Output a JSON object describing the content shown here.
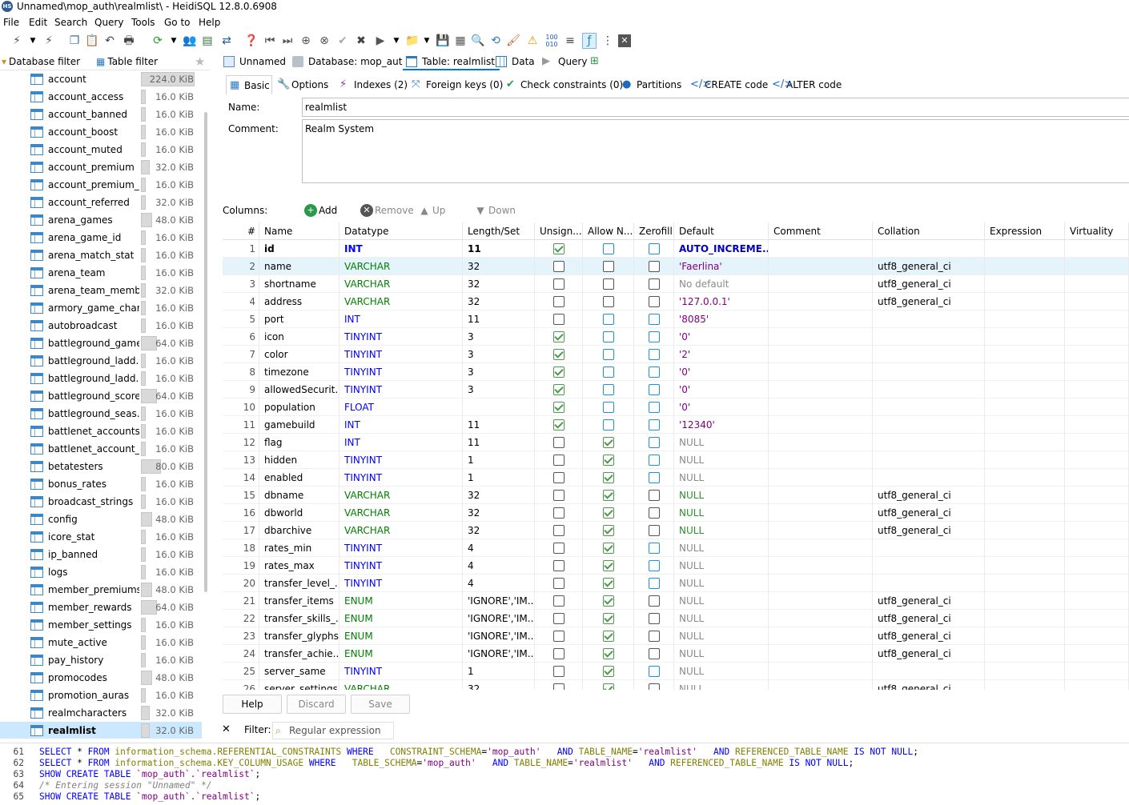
{
  "window": {
    "title": "Unnamed\\mop_auth\\realmlist\\ - HeidiSQL 12.8.0.6908",
    "app_icon": "HS"
  },
  "menu": [
    "File",
    "Edit",
    "Search",
    "Query",
    "Tools",
    "Go to",
    "Help"
  ],
  "left_tabs": {
    "database_filter": "Database filter",
    "table_filter": "Table filter"
  },
  "tree": [
    {
      "name": "account",
      "size": "224.0 KiB",
      "bar": 0.95
    },
    {
      "name": "account_access",
      "size": "16.0 KiB",
      "bar": 0.05
    },
    {
      "name": "account_banned",
      "size": "16.0 KiB",
      "bar": 0.05
    },
    {
      "name": "account_boost",
      "size": "16.0 KiB",
      "bar": 0.05
    },
    {
      "name": "account_muted",
      "size": "16.0 KiB",
      "bar": 0.05
    },
    {
      "name": "account_premium",
      "size": "32.0 KiB",
      "bar": 0.15
    },
    {
      "name": "account_premium_...",
      "size": "16.0 KiB",
      "bar": 0.05
    },
    {
      "name": "account_referred",
      "size": "32.0 KiB",
      "bar": 0.05
    },
    {
      "name": "arena_games",
      "size": "48.0 KiB",
      "bar": 0.2
    },
    {
      "name": "arena_game_id",
      "size": "16.0 KiB",
      "bar": 0.05
    },
    {
      "name": "arena_match_stat",
      "size": "16.0 KiB",
      "bar": 0.05
    },
    {
      "name": "arena_team",
      "size": "16.0 KiB",
      "bar": 0.05
    },
    {
      "name": "arena_team_member",
      "size": "32.0 KiB",
      "bar": 0.05
    },
    {
      "name": "armory_game_chart",
      "size": "16.0 KiB",
      "bar": 0.05
    },
    {
      "name": "autobroadcast",
      "size": "16.0 KiB",
      "bar": 0.05
    },
    {
      "name": "battleground_games",
      "size": "64.0 KiB",
      "bar": 0.28
    },
    {
      "name": "battleground_ladd...",
      "size": "16.0 KiB",
      "bar": 0.05
    },
    {
      "name": "battleground_ladd...",
      "size": "16.0 KiB",
      "bar": 0.05
    },
    {
      "name": "battleground_scores",
      "size": "64.0 KiB",
      "bar": 0.28
    },
    {
      "name": "battleground_seas...",
      "size": "16.0 KiB",
      "bar": 0.05
    },
    {
      "name": "battlenet_accounts",
      "size": "16.0 KiB",
      "bar": 0.05
    },
    {
      "name": "battlenet_account_...",
      "size": "16.0 KiB",
      "bar": 0.05
    },
    {
      "name": "betatesters",
      "size": "80.0 KiB",
      "bar": 0.36
    },
    {
      "name": "bonus_rates",
      "size": "16.0 KiB",
      "bar": 0.05
    },
    {
      "name": "broadcast_strings",
      "size": "16.0 KiB",
      "bar": 0.05
    },
    {
      "name": "config",
      "size": "48.0 KiB",
      "bar": 0.2
    },
    {
      "name": "icore_stat",
      "size": "16.0 KiB",
      "bar": 0.05
    },
    {
      "name": "ip_banned",
      "size": "16.0 KiB",
      "bar": 0.05
    },
    {
      "name": "logs",
      "size": "16.0 KiB",
      "bar": 0.05
    },
    {
      "name": "member_premiums",
      "size": "48.0 KiB",
      "bar": 0.2
    },
    {
      "name": "member_rewards",
      "size": "64.0 KiB",
      "bar": 0.28
    },
    {
      "name": "member_settings",
      "size": "16.0 KiB",
      "bar": 0.05
    },
    {
      "name": "mute_active",
      "size": "16.0 KiB",
      "bar": 0.05
    },
    {
      "name": "pay_history",
      "size": "16.0 KiB",
      "bar": 0.05
    },
    {
      "name": "promocodes",
      "size": "48.0 KiB",
      "bar": 0.2
    },
    {
      "name": "promotion_auras",
      "size": "16.0 KiB",
      "bar": 0.05
    },
    {
      "name": "realmcharacters",
      "size": "32.0 KiB",
      "bar": 0.15
    },
    {
      "name": "realmlist",
      "size": "32.0 KiB",
      "bar": 0.15,
      "selected": true
    }
  ],
  "right_tabs": [
    "Unnamed",
    "Database: mop_auth",
    "Table: realmlist",
    "Data",
    "Query"
  ],
  "sub_tabs": [
    "Basic",
    "Options",
    "Indexes (2)",
    "Foreign keys (0)",
    "Check constraints (0)",
    "Partitions",
    "CREATE code",
    "ALTER code"
  ],
  "form": {
    "name_label": "Name:",
    "name_value": "realmlist",
    "comment_label": "Comment:",
    "comment_value": "Realm System"
  },
  "columns_bar": {
    "label": "Columns:",
    "add": "Add",
    "remove": "Remove",
    "up": "Up",
    "down": "Down"
  },
  "grid_headers": [
    "#",
    "Name",
    "Datatype",
    "Length/Set",
    "Unsign...",
    "Allow N...",
    "Zerofill",
    "Default",
    "Comment",
    "Collation",
    "Expression",
    "Virtuality"
  ],
  "rows": [
    {
      "n": "1",
      "name": "id",
      "type": "INT",
      "len": "11",
      "u": true,
      "an": false,
      "zf": false,
      "def": "AUTO_INCREME...",
      "defc": "auto",
      "col": "",
      "key": "primary",
      "bold": true,
      "blue_an": false,
      "blue_zf": true,
      "blue_u": false
    },
    {
      "n": "2",
      "name": "name",
      "type": "VARCHAR",
      "len": "32",
      "u": false,
      "an": false,
      "zf": false,
      "def": "'Faerlina'",
      "defc": "str",
      "col": "utf8_general_ci",
      "key": "unique",
      "sel": true
    },
    {
      "n": "3",
      "name": "shortname",
      "type": "VARCHAR",
      "len": "32",
      "u": false,
      "an": false,
      "zf": false,
      "def": "No default",
      "defc": "nodef",
      "col": "utf8_general_ci"
    },
    {
      "n": "4",
      "name": "address",
      "type": "VARCHAR",
      "len": "32",
      "u": false,
      "an": false,
      "zf": false,
      "def": "'127.0.0.1'",
      "defc": "str",
      "col": "utf8_general_ci"
    },
    {
      "n": "5",
      "name": "port",
      "type": "INT",
      "len": "11",
      "u": false,
      "an": false,
      "zf": false,
      "def": "'8085'",
      "defc": "str",
      "col": ""
    },
    {
      "n": "6",
      "name": "icon",
      "type": "TINYINT",
      "len": "3",
      "u": true,
      "an": false,
      "zf": false,
      "def": "'0'",
      "defc": "str",
      "col": ""
    },
    {
      "n": "7",
      "name": "color",
      "type": "TINYINT",
      "len": "3",
      "u": true,
      "an": false,
      "zf": false,
      "def": "'2'",
      "defc": "str",
      "col": ""
    },
    {
      "n": "8",
      "name": "timezone",
      "type": "TINYINT",
      "len": "3",
      "u": true,
      "an": false,
      "zf": false,
      "def": "'0'",
      "defc": "str",
      "col": ""
    },
    {
      "n": "9",
      "name": "allowedSecurit...",
      "type": "TINYINT",
      "len": "3",
      "u": true,
      "an": false,
      "zf": false,
      "def": "'0'",
      "defc": "str",
      "col": ""
    },
    {
      "n": "10",
      "name": "population",
      "type": "FLOAT",
      "len": "",
      "u": true,
      "an": false,
      "zf": false,
      "def": "'0'",
      "defc": "str",
      "col": ""
    },
    {
      "n": "11",
      "name": "gamebuild",
      "type": "INT",
      "len": "11",
      "u": true,
      "an": false,
      "zf": false,
      "def": "'12340'",
      "defc": "str",
      "col": ""
    },
    {
      "n": "12",
      "name": "flag",
      "type": "INT",
      "len": "11",
      "u": false,
      "an": true,
      "zf": false,
      "def": "NULL",
      "defc": "null",
      "col": ""
    },
    {
      "n": "13",
      "name": "hidden",
      "type": "TINYINT",
      "len": "1",
      "u": false,
      "an": true,
      "zf": false,
      "def": "NULL",
      "defc": "null",
      "col": ""
    },
    {
      "n": "14",
      "name": "enabled",
      "type": "TINYINT",
      "len": "1",
      "u": false,
      "an": true,
      "zf": false,
      "def": "NULL",
      "defc": "null",
      "col": ""
    },
    {
      "n": "15",
      "name": "dbname",
      "type": "VARCHAR",
      "len": "32",
      "u": false,
      "an": true,
      "zf": false,
      "def": "NULL",
      "defc": "green",
      "col": "utf8_general_ci"
    },
    {
      "n": "16",
      "name": "dbworld",
      "type": "VARCHAR",
      "len": "32",
      "u": false,
      "an": true,
      "zf": false,
      "def": "NULL",
      "defc": "green",
      "col": "utf8_general_ci"
    },
    {
      "n": "17",
      "name": "dbarchive",
      "type": "VARCHAR",
      "len": "32",
      "u": false,
      "an": true,
      "zf": false,
      "def": "NULL",
      "defc": "green",
      "col": "utf8_general_ci"
    },
    {
      "n": "18",
      "name": "rates_min",
      "type": "TINYINT",
      "len": "4",
      "u": false,
      "an": true,
      "zf": false,
      "def": "NULL",
      "defc": "null",
      "col": ""
    },
    {
      "n": "19",
      "name": "rates_max",
      "type": "TINYINT",
      "len": "4",
      "u": false,
      "an": true,
      "zf": false,
      "def": "NULL",
      "defc": "null",
      "col": ""
    },
    {
      "n": "20",
      "name": "transfer_level_...",
      "type": "TINYINT",
      "len": "4",
      "u": false,
      "an": true,
      "zf": false,
      "def": "NULL",
      "defc": "null",
      "col": ""
    },
    {
      "n": "21",
      "name": "transfer_items",
      "type": "ENUM",
      "len": "'IGNORE','IM...",
      "u": false,
      "an": true,
      "zf": false,
      "def": "NULL",
      "defc": "null",
      "col": "utf8_general_ci"
    },
    {
      "n": "22",
      "name": "transfer_skills_...",
      "type": "ENUM",
      "len": "'IGNORE','IM...",
      "u": false,
      "an": true,
      "zf": false,
      "def": "NULL",
      "defc": "null",
      "col": "utf8_general_ci"
    },
    {
      "n": "23",
      "name": "transfer_glyphs",
      "type": "ENUM",
      "len": "'IGNORE','IM...",
      "u": false,
      "an": true,
      "zf": false,
      "def": "NULL",
      "defc": "null",
      "col": "utf8_general_ci"
    },
    {
      "n": "24",
      "name": "transfer_achie...",
      "type": "ENUM",
      "len": "'IGNORE','IM...",
      "u": false,
      "an": true,
      "zf": false,
      "def": "NULL",
      "defc": "null",
      "col": "utf8_general_ci"
    },
    {
      "n": "25",
      "name": "server_same",
      "type": "TINYINT",
      "len": "1",
      "u": false,
      "an": true,
      "zf": false,
      "def": "NULL",
      "defc": "null",
      "col": ""
    },
    {
      "n": "26",
      "name": "server_settings",
      "type": "VARCHAR",
      "len": "32",
      "u": false,
      "an": true,
      "zf": false,
      "def": "NULL",
      "defc": "null",
      "col": "utf8_general_ci"
    }
  ],
  "buttons": {
    "help": "Help",
    "discard": "Discard",
    "save": "Save"
  },
  "filter": {
    "label": "Filter:",
    "placeholder": "Regular expression"
  },
  "log": [
    {
      "n": "61"
    },
    {
      "n": "62"
    },
    {
      "n": "63"
    },
    {
      "n": "64"
    },
    {
      "n": "65"
    }
  ],
  "log_text": {
    "l61": [
      "SELECT",
      " * ",
      "FROM",
      " information_schema.",
      "REFERENTIAL_CONSTRAINTS",
      " WHERE   ",
      "CONSTRAINT_SCHEMA",
      "=",
      "'mop_auth'",
      "   AND ",
      "TABLE_NAME",
      "=",
      "'realmlist'",
      "   AND ",
      "REFERENCED_TABLE_NAME",
      " IS NOT NULL",
      ";"
    ],
    "l62": [
      "SELECT",
      " * ",
      "FROM",
      " information_schema.",
      "KEY_COLUMN_USAGE",
      " WHERE   ",
      "TABLE_SCHEMA",
      "=",
      "'mop_auth'",
      "   AND ",
      "TABLE_NAME",
      "=",
      "'realmlist'",
      "   AND ",
      "REFERENCED_TABLE_NAME",
      " IS NOT NULL",
      ";"
    ],
    "l63": [
      "SHOW CREATE TABLE",
      " `mop_auth`.`realmlist`",
      ";"
    ],
    "l64": [
      "/* Entering session \"Unnamed\" */"
    ],
    "l65": [
      "SHOW CREATE TABLE",
      " `mop_auth`.`realmlist`",
      ";"
    ]
  }
}
